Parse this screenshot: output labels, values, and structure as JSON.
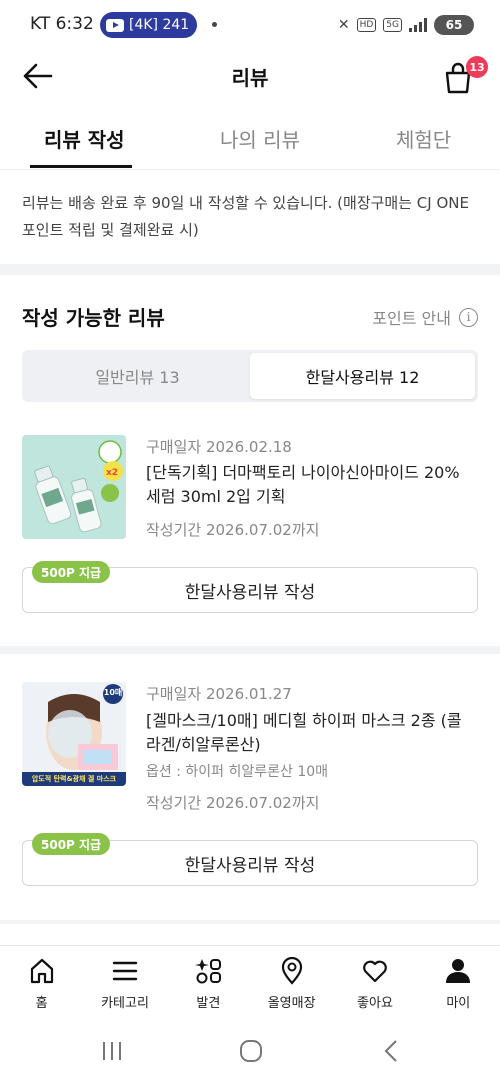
{
  "status_bar": {
    "time": "KT 6:32",
    "media_pill": "[4K] 241",
    "net_small_1": "HD",
    "net_small_2": "5G",
    "battery": "65"
  },
  "header": {
    "title": "리뷰",
    "cart_count": "13"
  },
  "tabs": [
    {
      "label": "리뷰 작성",
      "active": true
    },
    {
      "label": "나의 리뷰",
      "active": false
    },
    {
      "label": "체험단",
      "active": false
    }
  ],
  "notice": "리뷰는 배송 완료 후 90일 내 작성할 수 있습니다. (매장구매는 CJ ONE 포인트 적립 및 결제완료 시)",
  "section": {
    "title": "작성 가능한 리뷰",
    "point_guide": "포인트 안내"
  },
  "segments": [
    {
      "label": "일반리뷰 13",
      "active": false
    },
    {
      "label": "한달사용리뷰 12",
      "active": true
    }
  ],
  "items": [
    {
      "purchase_date": "구매일자 2026.02.18",
      "name": "[단독기획] 더마팩토리 나이아신아마이드 20% 세럼 30ml 2입 기획",
      "option": "",
      "period": "작성기간 2026.07.02까지",
      "point_tag": "500P 지급",
      "button": "한달사용리뷰 작성",
      "thumb_badge": "x2"
    },
    {
      "purchase_date": "구매일자 2026.01.27",
      "name": "[겔마스크/10매] 메디힐 하이퍼 마스크 2종 (콜라겐/히알루론산)",
      "option": "옵션 : 하이퍼 히알루론산 10매",
      "period": "작성기간 2026.07.02까지",
      "point_tag": "500P 지급",
      "button": "한달사용리뷰 작성",
      "thumb_badge": "10매",
      "thumb_banner": "압도적 탄력&광채 겔 마스크"
    }
  ],
  "bottom_nav": [
    {
      "label": "홈",
      "icon": "home-icon"
    },
    {
      "label": "카테고리",
      "icon": "menu-icon"
    },
    {
      "label": "발견",
      "icon": "discover-icon"
    },
    {
      "label": "올영매장",
      "icon": "location-icon"
    },
    {
      "label": "좋아요",
      "icon": "heart-icon"
    },
    {
      "label": "마이",
      "icon": "person-icon"
    }
  ],
  "colors": {
    "accent_green": "#8bc34a",
    "badge_red": "#f03a5a",
    "media_pill": "#2d3a9e"
  }
}
